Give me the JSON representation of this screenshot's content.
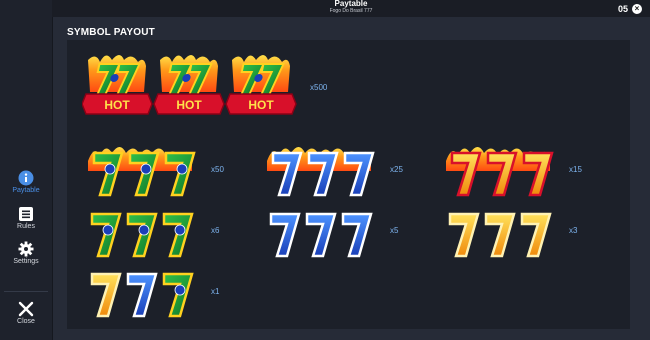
{
  "header": {
    "title": "Paytable",
    "subtitle": "Fogo Do Brasil 777",
    "clock": "05",
    "close_glyph": "×"
  },
  "sidebar": {
    "items": [
      {
        "label": "Paytable",
        "icon": "info-icon",
        "active": true
      },
      {
        "label": "Rules",
        "icon": "document-icon"
      },
      {
        "label": "Settings",
        "icon": "gear-icon"
      },
      {
        "label": "Close",
        "icon": "close-icon"
      }
    ]
  },
  "section": {
    "title": "SYMBOL PAYOUT"
  },
  "payouts": [
    {
      "symbol": "hot-777-brazil",
      "multiplier": "x500",
      "badge": "HOT"
    },
    {
      "symbol": "burning-777-brazil",
      "multiplier": "x50"
    },
    {
      "symbol": "burning-777-blue",
      "multiplier": "x25"
    },
    {
      "symbol": "burning-777-gold",
      "multiplier": "x15"
    },
    {
      "symbol": "777-brazil",
      "multiplier": "x6"
    },
    {
      "symbol": "777-blue",
      "multiplier": "x5"
    },
    {
      "symbol": "777-gold",
      "multiplier": "x3"
    },
    {
      "symbol": "777-mixed",
      "multiplier": "x1"
    }
  ],
  "colors": {
    "accent": "#4a8fe6",
    "multiplier": "#7db3ee",
    "panel": "#1c2029",
    "background": "#262b37",
    "brazil_green": "#1f9e3a",
    "brazil_yellow": "#ffd21f",
    "blue": "#2a66e0",
    "gold": "#f5b41c",
    "hot_red": "#d8102a",
    "flame": "#ff8a12"
  }
}
